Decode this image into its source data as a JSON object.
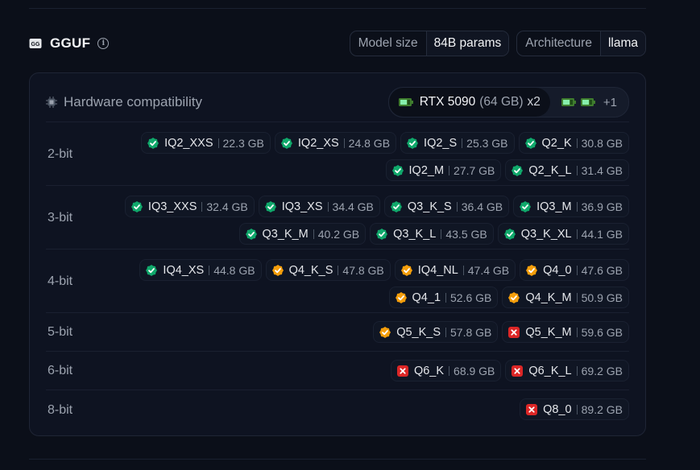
{
  "header": {
    "title": "GGUF",
    "meta": [
      {
        "key": "Model size",
        "value": "84B params"
      },
      {
        "key": "Architecture",
        "value": "llama"
      }
    ]
  },
  "hardware": {
    "title": "Hardware compatibility",
    "gpu": {
      "name": "RTX 5090",
      "memory": "(64 GB)",
      "multiplier": "x2"
    },
    "extra": "+1"
  },
  "colors": {
    "fits": "#10a86b",
    "partial": "#f59e0b",
    "no": "#dc2626"
  },
  "rows": [
    {
      "label": "2-bit",
      "lines": [
        [
          {
            "name": "IQ2_XXS",
            "size": "22.3 GB",
            "status": "fits"
          },
          {
            "name": "IQ2_XS",
            "size": "24.8 GB",
            "status": "fits"
          },
          {
            "name": "IQ2_S",
            "size": "25.3 GB",
            "status": "fits"
          },
          {
            "name": "Q2_K",
            "size": "30.8 GB",
            "status": "fits"
          }
        ],
        [
          {
            "name": "IQ2_M",
            "size": "27.7 GB",
            "status": "fits"
          },
          {
            "name": "Q2_K_L",
            "size": "31.4 GB",
            "status": "fits"
          }
        ]
      ]
    },
    {
      "label": "3-bit",
      "lines": [
        [
          {
            "name": "IQ3_XXS",
            "size": "32.4 GB",
            "status": "fits"
          },
          {
            "name": "IQ3_XS",
            "size": "34.4 GB",
            "status": "fits"
          },
          {
            "name": "Q3_K_S",
            "size": "36.4 GB",
            "status": "fits"
          },
          {
            "name": "IQ3_M",
            "size": "36.9 GB",
            "status": "fits"
          }
        ],
        [
          {
            "name": "Q3_K_M",
            "size": "40.2 GB",
            "status": "fits"
          },
          {
            "name": "Q3_K_L",
            "size": "43.5 GB",
            "status": "fits"
          },
          {
            "name": "Q3_K_XL",
            "size": "44.1 GB",
            "status": "fits"
          }
        ]
      ]
    },
    {
      "label": "4-bit",
      "lines": [
        [
          {
            "name": "IQ4_XS",
            "size": "44.8 GB",
            "status": "fits"
          },
          {
            "name": "Q4_K_S",
            "size": "47.8 GB",
            "status": "partial"
          },
          {
            "name": "IQ4_NL",
            "size": "47.4 GB",
            "status": "partial"
          },
          {
            "name": "Q4_0",
            "size": "47.6 GB",
            "status": "partial"
          }
        ],
        [
          {
            "name": "Q4_1",
            "size": "52.6 GB",
            "status": "partial"
          },
          {
            "name": "Q4_K_M",
            "size": "50.9 GB",
            "status": "partial"
          }
        ]
      ]
    },
    {
      "label": "5-bit",
      "lines": [
        [
          {
            "name": "Q5_K_S",
            "size": "57.8 GB",
            "status": "partial"
          },
          {
            "name": "Q5_K_M",
            "size": "59.6 GB",
            "status": "no"
          }
        ]
      ]
    },
    {
      "label": "6-bit",
      "lines": [
        [
          {
            "name": "Q6_K",
            "size": "68.9 GB",
            "status": "no"
          },
          {
            "name": "Q6_K_L",
            "size": "69.2 GB",
            "status": "no"
          }
        ]
      ]
    },
    {
      "label": "8-bit",
      "lines": [
        [
          {
            "name": "Q8_0",
            "size": "89.2 GB",
            "status": "no"
          }
        ]
      ]
    }
  ]
}
